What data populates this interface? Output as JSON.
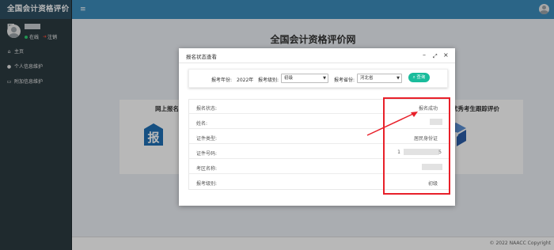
{
  "app": {
    "brand": "全国会计资格评价网"
  },
  "user": {
    "status": "在线",
    "logout": "注销"
  },
  "sidebar": {
    "items": [
      {
        "icon": "home-icon",
        "label": "主页"
      },
      {
        "icon": "user-icon",
        "label": "个人信息维护"
      },
      {
        "icon": "id-card-icon",
        "label": "附加信息维护"
      }
    ]
  },
  "main": {
    "title": "全国会计资格评价网",
    "cards": [
      {
        "label": "网上报名",
        "icon_char": "报"
      },
      {
        "label": "优秀考生跟踪评价"
      }
    ]
  },
  "footer": {
    "copyright": "© 2022 NAACC Copyright"
  },
  "modal": {
    "title": "报名状态查看",
    "filter": {
      "year_label": "报考年份:",
      "year_value": "2022年",
      "level_label": "报考级别:",
      "level_value": "初级",
      "province_label": "报考省份:",
      "province_value": "河北省",
      "search_label": "查询"
    },
    "rows": [
      {
        "label": "报名状态:",
        "value": "报名成功"
      },
      {
        "label": "姓名:",
        "value": ""
      },
      {
        "label": "证件类型:",
        "value": "居民身份证"
      },
      {
        "label": "证件号码:",
        "value_start": "1",
        "value_end": "5"
      },
      {
        "label": "考区名称:",
        "value": ""
      },
      {
        "label": "报考级别:",
        "value": "初级"
      }
    ]
  },
  "colors": {
    "topbar": "#3c8dbc",
    "sidebar": "#2c3b41",
    "accent_button": "#1abc9c",
    "annotation": "#e8202a",
    "signup_icon": "#1f6fb5"
  }
}
